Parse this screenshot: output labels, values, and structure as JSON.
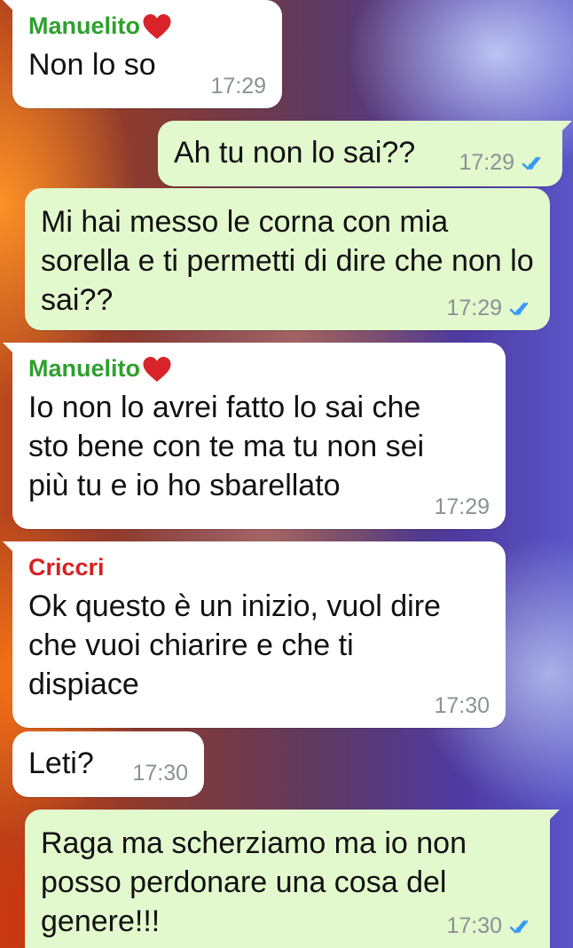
{
  "colors": {
    "sender_manuelito": "#2ea02e",
    "sender_criccri": "#d62020",
    "incoming_bubble": "#ffffff",
    "outgoing_bubble": "#e2f8cd",
    "read_ticks": "#3497f9"
  },
  "messages": [
    {
      "direction": "in",
      "sender": "Manuelito",
      "heart_icon": "red-heart-icon",
      "text": "Non lo so",
      "time": "17:29"
    },
    {
      "direction": "out",
      "text": "Ah tu non lo sai??",
      "time": "17:29",
      "status_icon": "double-check-read-icon"
    },
    {
      "direction": "out",
      "text": "Mi hai messo le corna con mia sorella e ti permetti di dire che non lo sai??",
      "time": "17:29",
      "status_icon": "double-check-read-icon"
    },
    {
      "direction": "in",
      "sender": "Manuelito",
      "heart_icon": "red-heart-icon",
      "text": "Io non lo avrei fatto lo sai che sto bene con te ma tu non sei più tu e io ho sbarellato",
      "time": "17:29"
    },
    {
      "direction": "in",
      "sender": "Criccri",
      "text": "Ok questo è un inizio, vuol dire che vuoi chiarire e che ti dispiace",
      "time": "17:30"
    },
    {
      "direction": "in",
      "text": "Leti?",
      "time": "17:30"
    },
    {
      "direction": "out",
      "text": "Raga ma scherziamo ma io non posso perdonare una cosa del genere!!!",
      "time": "17:30",
      "status_icon": "double-check-read-icon"
    }
  ]
}
